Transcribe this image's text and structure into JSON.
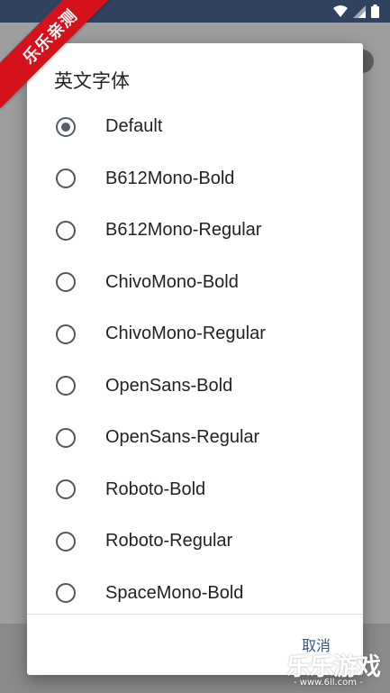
{
  "status_bar": {
    "icons": [
      "wifi-icon",
      "signal-icon",
      "battery-icon"
    ]
  },
  "ribbon": {
    "text": "乐乐亲测"
  },
  "dialog": {
    "title": "英文字体",
    "options": [
      {
        "label": "Default",
        "selected": true
      },
      {
        "label": "B612Mono-Bold",
        "selected": false
      },
      {
        "label": "B612Mono-Regular",
        "selected": false
      },
      {
        "label": "ChivoMono-Bold",
        "selected": false
      },
      {
        "label": "ChivoMono-Regular",
        "selected": false
      },
      {
        "label": "OpenSans-Bold",
        "selected": false
      },
      {
        "label": "OpenSans-Regular",
        "selected": false
      },
      {
        "label": "Roboto-Bold",
        "selected": false
      },
      {
        "label": "Roboto-Regular",
        "selected": false
      },
      {
        "label": "SpaceMono-Bold",
        "selected": false
      }
    ],
    "cancel_label": "取消"
  },
  "watermark": {
    "title": "乐乐游戏",
    "url": "- www.6ll.com -"
  },
  "colors": {
    "status_bar": "#31425f",
    "ribbon": "#d5121b",
    "accent": "#545c6e",
    "cancel": "#31578a"
  }
}
